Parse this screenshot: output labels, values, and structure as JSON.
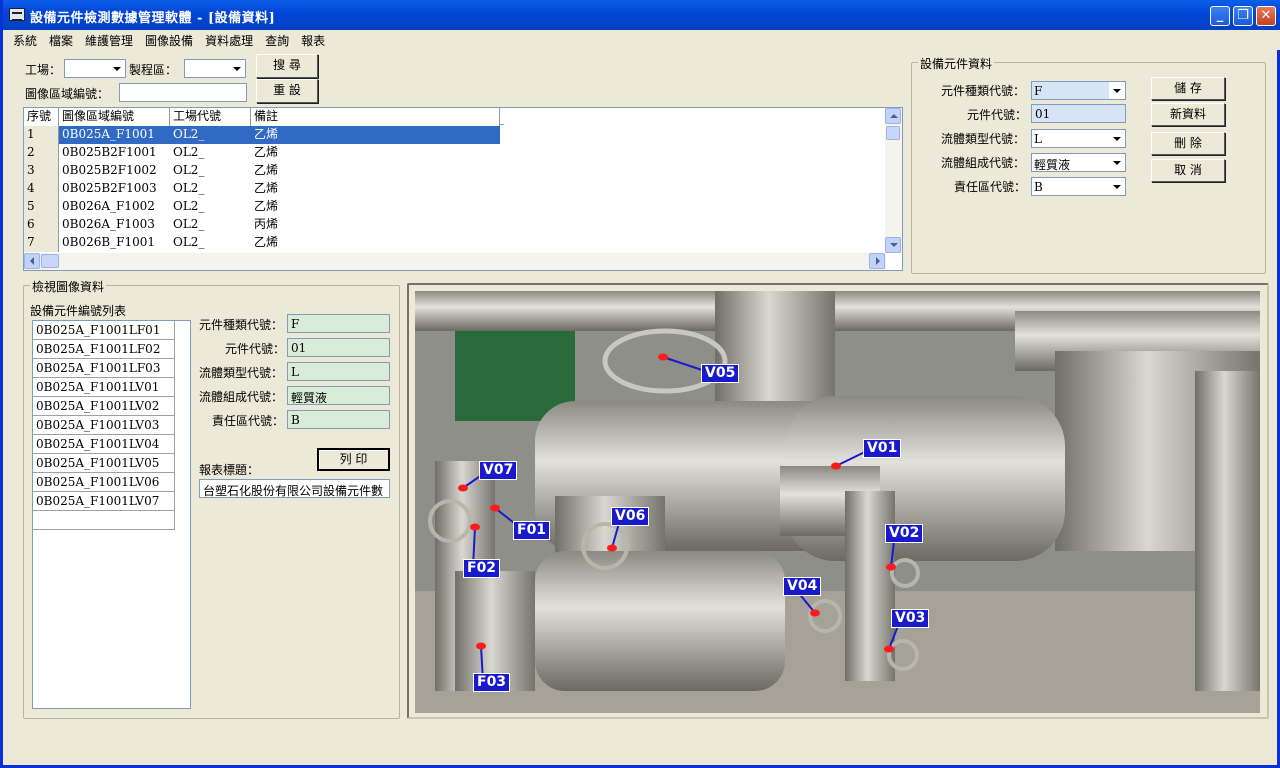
{
  "window": {
    "title": "設備元件檢測數據管理軟體 - [設備資料]",
    "controls": [
      "minimize-icon",
      "restore-icon",
      "close-icon"
    ]
  },
  "menu": [
    "系統",
    "檔案",
    "維護管理",
    "圖像設備",
    "資料處理",
    "查詢",
    "報表"
  ],
  "search": {
    "factory_label": "工場：",
    "factory_value": "",
    "process_label": "製程區：",
    "process_value": "",
    "image_area_label": "圖像區域編號：",
    "image_area_value": "",
    "search_button": "搜 尋",
    "reset_button": "重 設"
  },
  "grid": {
    "headers": [
      "序號",
      "圖像區域編號",
      "工場代號",
      "備註"
    ],
    "rows": [
      [
        "1",
        "0B025A_F1001",
        "OL2_",
        "乙烯"
      ],
      [
        "2",
        "0B025B2F1001",
        "OL2_",
        "乙烯"
      ],
      [
        "3",
        "0B025B2F1002",
        "OL2_",
        "乙烯"
      ],
      [
        "4",
        "0B025B2F1003",
        "OL2_",
        "乙烯"
      ],
      [
        "5",
        "0B026A_F1002",
        "OL2_",
        "乙烯"
      ],
      [
        "6",
        "0B026A_F1003",
        "OL2_",
        "丙烯"
      ],
      [
        "7",
        "0B026B_F1001",
        "OL2_",
        "乙烯"
      ]
    ],
    "selected_row": 0
  },
  "equipment": {
    "group_title": "設備元件資料",
    "type_label": "元件種類代號：",
    "type_value": "F",
    "code_label": "元件代號：",
    "code_value": "01",
    "fluid_type_label": "流體類型代號：",
    "fluid_type_value": "L",
    "fluid_comp_label": "流體組成代號：",
    "fluid_comp_value": "輕質液",
    "resp_label": "責任區代號：",
    "resp_value": "B",
    "save_button": "儲 存",
    "new_button": "新資料",
    "delete_button": "刪 除",
    "cancel_button": "取 消"
  },
  "viewer": {
    "group_title": "檢視圖像資料",
    "list_title": "設備元件編號列表",
    "list_items": [
      "0B025A_F1001LF01",
      "0B025A_F1001LF02",
      "0B025A_F1001LF03",
      "0B025A_F1001LV01",
      "0B025A_F1001LV02",
      "0B025A_F1001LV03",
      "0B025A_F1001LV04",
      "0B025A_F1001LV05",
      "0B025A_F1001LV06",
      "0B025A_F1001LV07"
    ],
    "type_label": "元件種類代號：",
    "type_value": "F",
    "code_label": "元件代號：",
    "code_value": "01",
    "fluid_type_label": "流體類型代號：",
    "fluid_type_value": "L",
    "fluid_comp_label": "流體組成代號：",
    "fluid_comp_value": "輕質液",
    "resp_label": "責任區代號：",
    "resp_value": "B",
    "print_button": "列 印",
    "report_title_label": "報表標題：",
    "report_title_value": "台塑石化股份有限公司設備元件數"
  },
  "photo_tags": [
    "V05",
    "V01",
    "V07",
    "F01",
    "V06",
    "V02",
    "F02",
    "V04",
    "V03",
    "F03"
  ],
  "colors": {
    "titlebar": "#0246d8",
    "selection": "#316ac5",
    "tag_bg": "#1a1acd",
    "marker": "#ff1a1a",
    "readonly_field": "#d8ecd8"
  }
}
